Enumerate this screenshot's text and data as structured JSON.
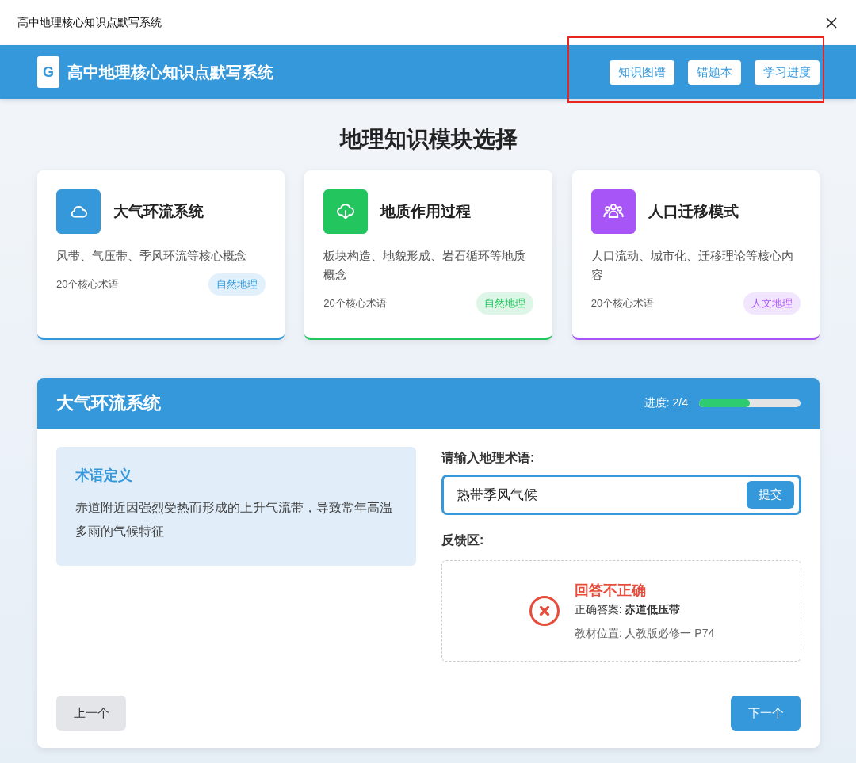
{
  "window": {
    "title": "高中地理核心知识点默写系统"
  },
  "header": {
    "logo": "G",
    "title": "高中地理核心知识点默写系统",
    "nav": [
      "知识图谱",
      "错题本",
      "学习进度"
    ]
  },
  "page_title": "地理知识模块选择",
  "modules": [
    {
      "kind": "cloud",
      "name": "大气环流系统",
      "description": "风带、气压带、季风环流等核心概念",
      "count": "20个核心术语",
      "tag": "自然地理",
      "color": "#3498db"
    },
    {
      "kind": "download",
      "name": "地质作用过程",
      "description": "板块构造、地貌形成、岩石循环等地质概念",
      "count": "20个核心术语",
      "tag": "自然地理",
      "color": "#22c55e"
    },
    {
      "kind": "people",
      "name": "人口迁移模式",
      "description": "人口流动、城市化、迁移理论等核心内容",
      "count": "20个核心术语",
      "tag": "人文地理",
      "color": "#a855f7"
    }
  ],
  "quiz": {
    "title": "大气环流系统",
    "progress_label": "进度: 2/4",
    "level": 0.5,
    "definition_title": "术语定义",
    "definition": "赤道附近因强烈受热而形成的上升气流带，导致常年高温多雨的气候特征",
    "input_label": "请输入地理术语:",
    "value": "热带季风气候",
    "submit": "提交",
    "feedback_label": "反馈区:",
    "feedback": {
      "correct": false,
      "title": "回答不正确",
      "answer": "正确答案: **赤道低压带**",
      "source": "教材位置: 人教版必修一 P74"
    },
    "prev": "上一个",
    "next": "下一个"
  }
}
